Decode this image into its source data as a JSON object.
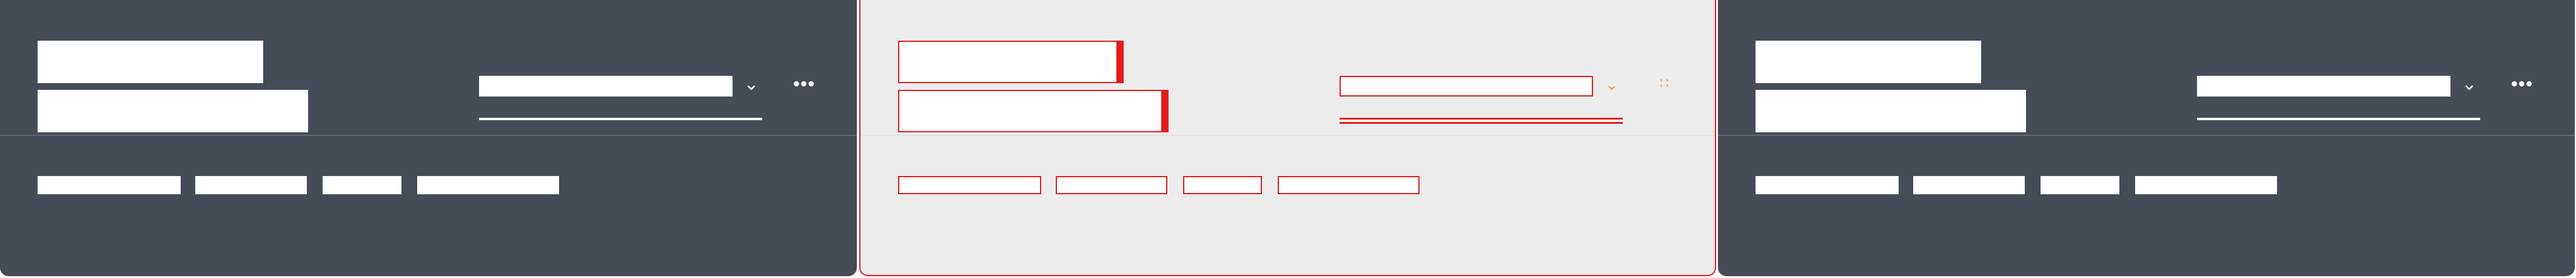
{
  "panels": [
    {
      "id": "dark-1",
      "theme": "dark",
      "title": "",
      "subtitle": "",
      "select": {
        "value": ""
      },
      "more_icon": "more-horizontal-icon",
      "chevron_icon": "chevron-down-icon",
      "tabs": [
        "",
        "",
        "",
        ""
      ]
    },
    {
      "id": "light-2",
      "theme": "light",
      "title": "",
      "subtitle": "",
      "select": {
        "value": ""
      },
      "more_icon": "more-horizontal-icon",
      "chevron_icon": "chevron-down-icon",
      "tabs": [
        "",
        "",
        "",
        ""
      ]
    },
    {
      "id": "dark-3",
      "theme": "dark",
      "title": "",
      "subtitle": "",
      "select": {
        "value": ""
      },
      "more_icon": "more-horizontal-icon",
      "chevron_icon": "chevron-down-icon",
      "tabs": [
        "",
        "",
        "",
        ""
      ]
    }
  ],
  "colors": {
    "dark_bg": "#454c57",
    "light_bg": "#ececec",
    "highlight_red": "#e31b1b",
    "icon_orange": "#f0a024",
    "accent_blue": "#1e3a8a"
  }
}
